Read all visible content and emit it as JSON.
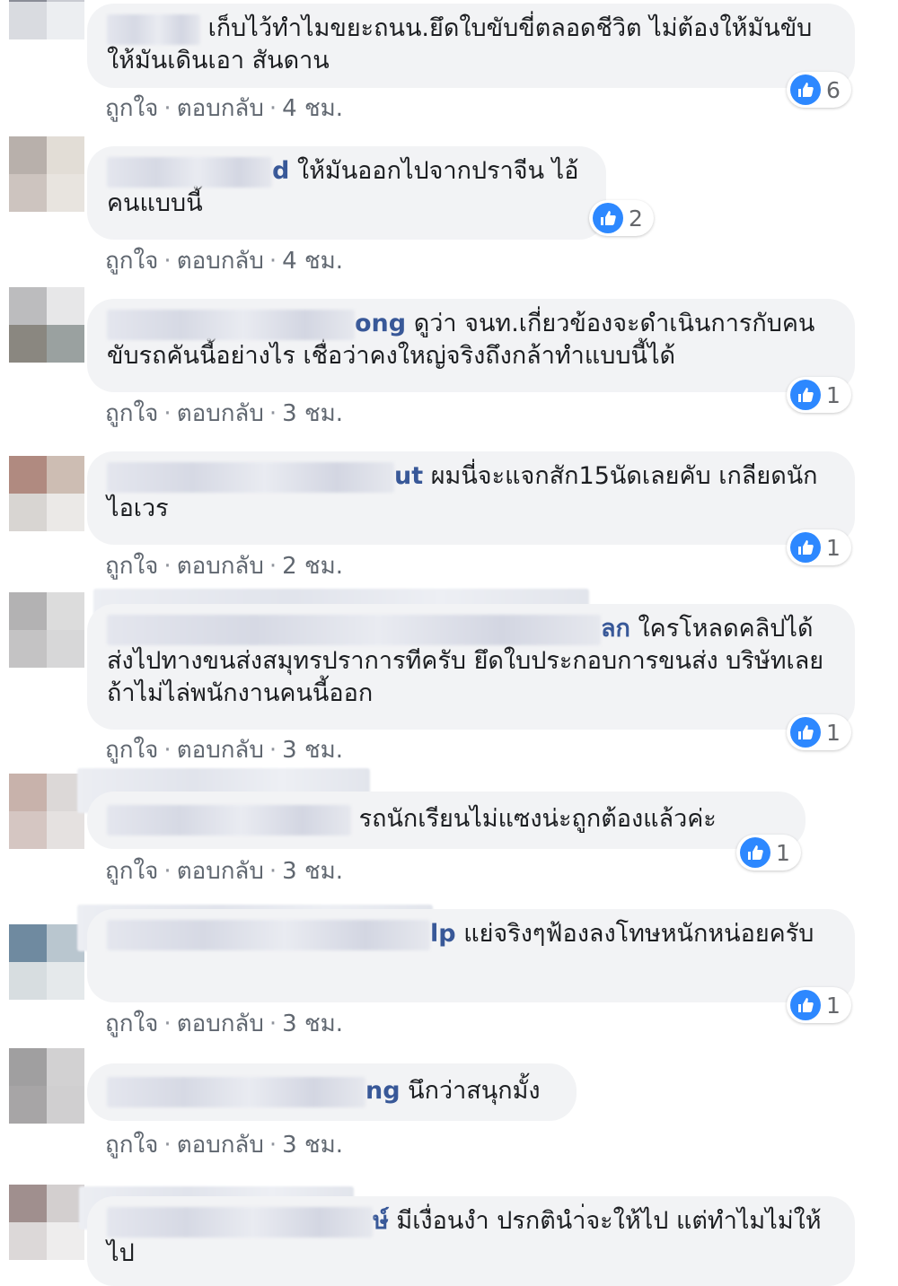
{
  "actions": {
    "like": "ถูกใจ",
    "reply": "ตอบกลับ",
    "separator": "·"
  },
  "colors": {
    "bubble": "#f2f3f5",
    "name": "#385898",
    "like_icon": "#2d88ff",
    "meta": "#606770"
  },
  "comments": [
    {
      "name": "",
      "text": "เก็บไว้ทำไมขยะถนน.ยึดใบขับขี่ตลอดชีวิต ไม่ต้องให้มันขับให้มันเดินเอา สันดาน",
      "likes": "6",
      "time": "4 ชม."
    },
    {
      "name": "d",
      "text": "ให้มันออกไปจากปราจีน ไอ้คนแบบนี้",
      "likes": "2",
      "time": "4 ชม."
    },
    {
      "name": "ong",
      "text": "ดูว่า จนท.เกี่ยวข้องจะดำเนินการกับคนขับรถคันนี้อย่างไร เชื่อว่าคงใหญ่จริงถึงกล้าทำแบบนี้ได้",
      "likes": "1",
      "time": "3 ชม."
    },
    {
      "name": "ut",
      "text": "ผมนี่จะแจกสัก15นัดเลยคับ เกลียดนักไอเวร",
      "likes": "1",
      "time": "2 ชม."
    },
    {
      "name": "ลก",
      "text": "ใครโหลดคลิปได้ ส่งไปทางขนส่งสมุทรปราการทีครับ ยึดใบประกอบการขนส่ง บริษัทเลย ถ้าไม่ไล่พนักงานคนนี้ออก",
      "likes": "1",
      "time": "3 ชม."
    },
    {
      "name": "",
      "text": "รถนักเรียนไม่แซงน่ะถูกต้องแล้วค่ะ",
      "likes": "1",
      "time": "3 ชม."
    },
    {
      "name": "lp",
      "text": "แย่จริงๆฟ้องลงโทษหนักหน่อยครับ",
      "likes": "1",
      "time": "3 ชม."
    },
    {
      "name": "ng",
      "text": "นึกว่าสนุกมั้ง",
      "likes": "",
      "time": "3 ชม."
    },
    {
      "name": "ษ์",
      "text": "มีเงื่อนงำ ปรกตินำ่จะให้ไป แต่ทำไมไม่ให้ไป",
      "likes": "",
      "time": ""
    }
  ]
}
